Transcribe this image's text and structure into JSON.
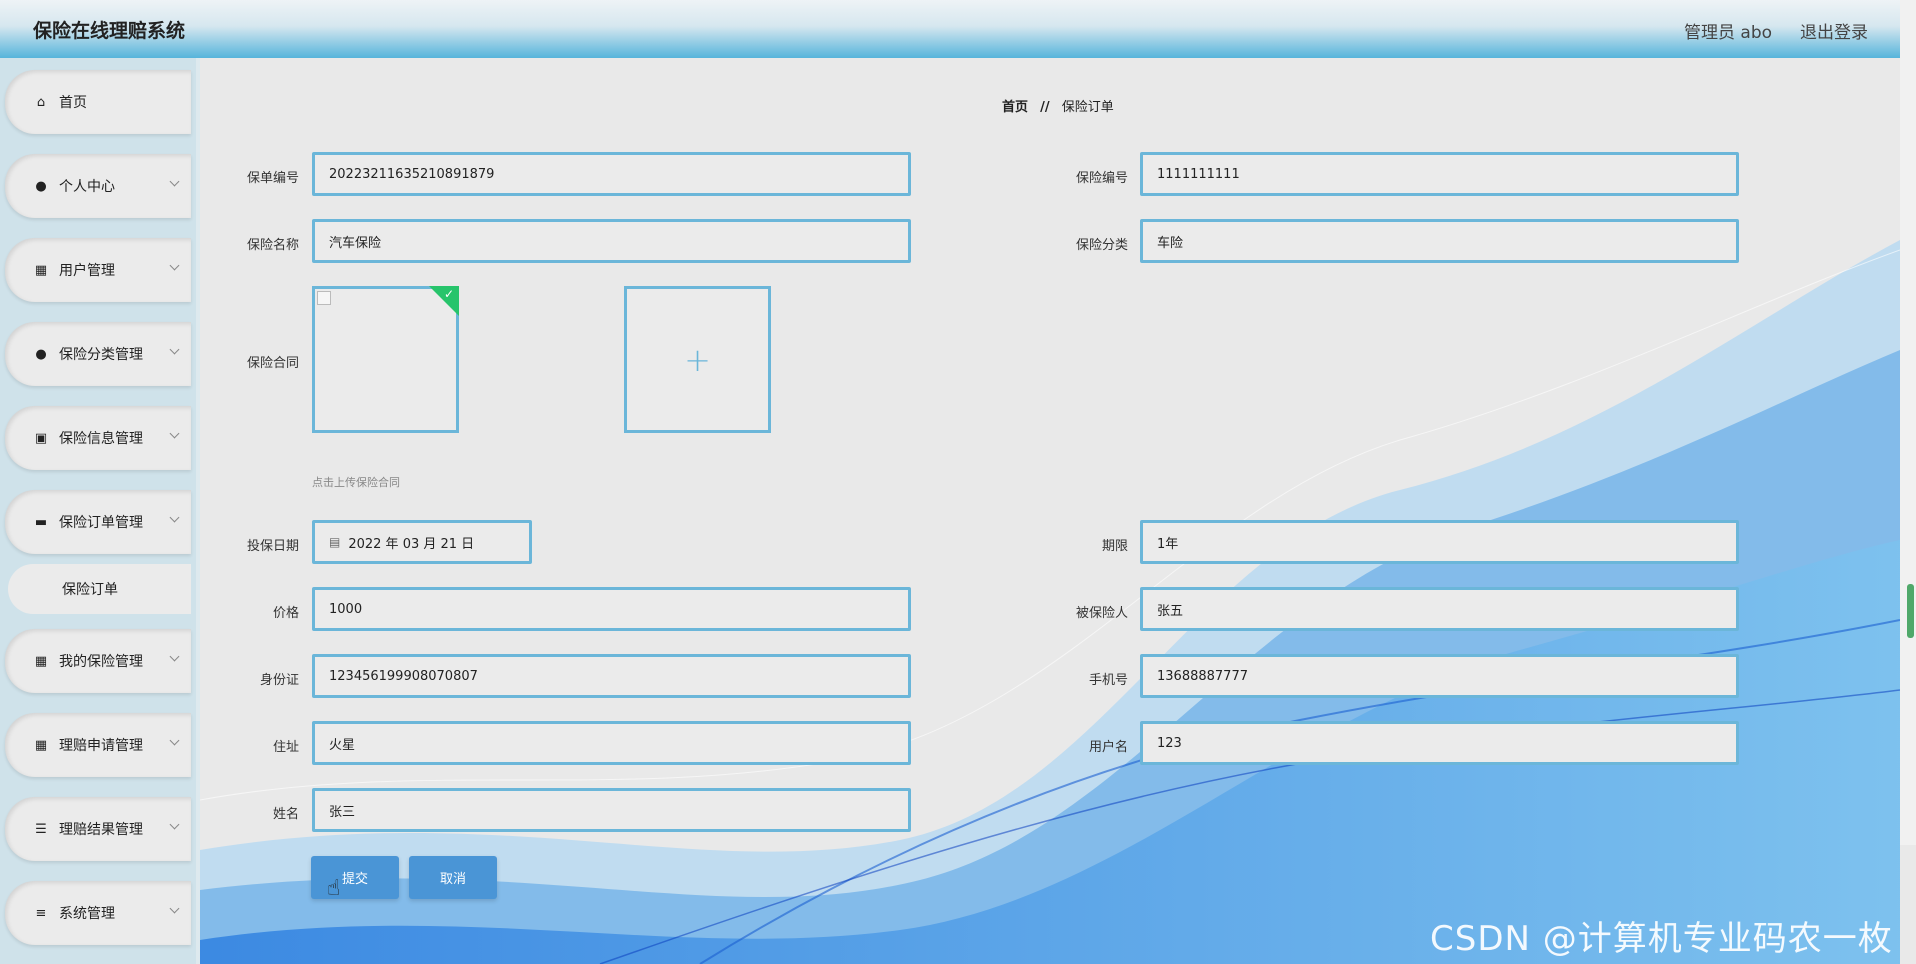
{
  "header": {
    "app_title": "保险在线理赔系统",
    "user_label": "管理员 abo",
    "logout": "退出登录"
  },
  "sidebar": {
    "items": [
      {
        "label": "首页",
        "icon": "home-icon"
      },
      {
        "label": "个人中心",
        "icon": "person-icon"
      },
      {
        "label": "用户管理",
        "icon": "grid-icon"
      },
      {
        "label": "保险分类管理",
        "icon": "bulb-icon"
      },
      {
        "label": "保险信息管理",
        "icon": "clipboard-icon"
      },
      {
        "label": "保险订单管理",
        "icon": "briefcase-icon"
      },
      {
        "label": "我的保险管理",
        "icon": "grid-icon"
      },
      {
        "label": "理赔申请管理",
        "icon": "grid-icon"
      },
      {
        "label": "理赔结果管理",
        "icon": "list-icon"
      },
      {
        "label": "系统管理",
        "icon": "sliders-icon"
      }
    ],
    "active_sub": "保险订单"
  },
  "breadcrumb": {
    "home": "首页",
    "separator": "//",
    "current": "保险订单"
  },
  "form": {
    "policy_no_label": "保单编号",
    "policy_no": "20223211635210891879",
    "insurance_no_label": "保险编号",
    "insurance_no": "1111111111",
    "insurance_name_label": "保险名称",
    "insurance_name": "汽车保险",
    "category_label": "保险分类",
    "category": "车险",
    "contract_label": "保险合同",
    "contract_hint": "点击上传保险合同",
    "date_label": "投保日期",
    "date": "2022 年 03 月 21 日",
    "term_label": "期限",
    "term": "1年",
    "price_label": "价格",
    "price": "1000",
    "insured_label": "被保险人",
    "insured": "张五",
    "id_label": "身份证",
    "id_no": "123456199908070807",
    "phone_label": "手机号",
    "phone": "13688887777",
    "address_label": "住址",
    "address": "火星",
    "username_label": "用户名",
    "username": "123",
    "name_label": "姓名",
    "name": "张三"
  },
  "buttons": {
    "submit": "提交",
    "cancel": "取消"
  },
  "watermark": "CSDN @计算机专业码农一枚",
  "colors": {
    "accent": "#4a95d6",
    "input_border": "#6bb6d9",
    "success": "#27c46b"
  }
}
